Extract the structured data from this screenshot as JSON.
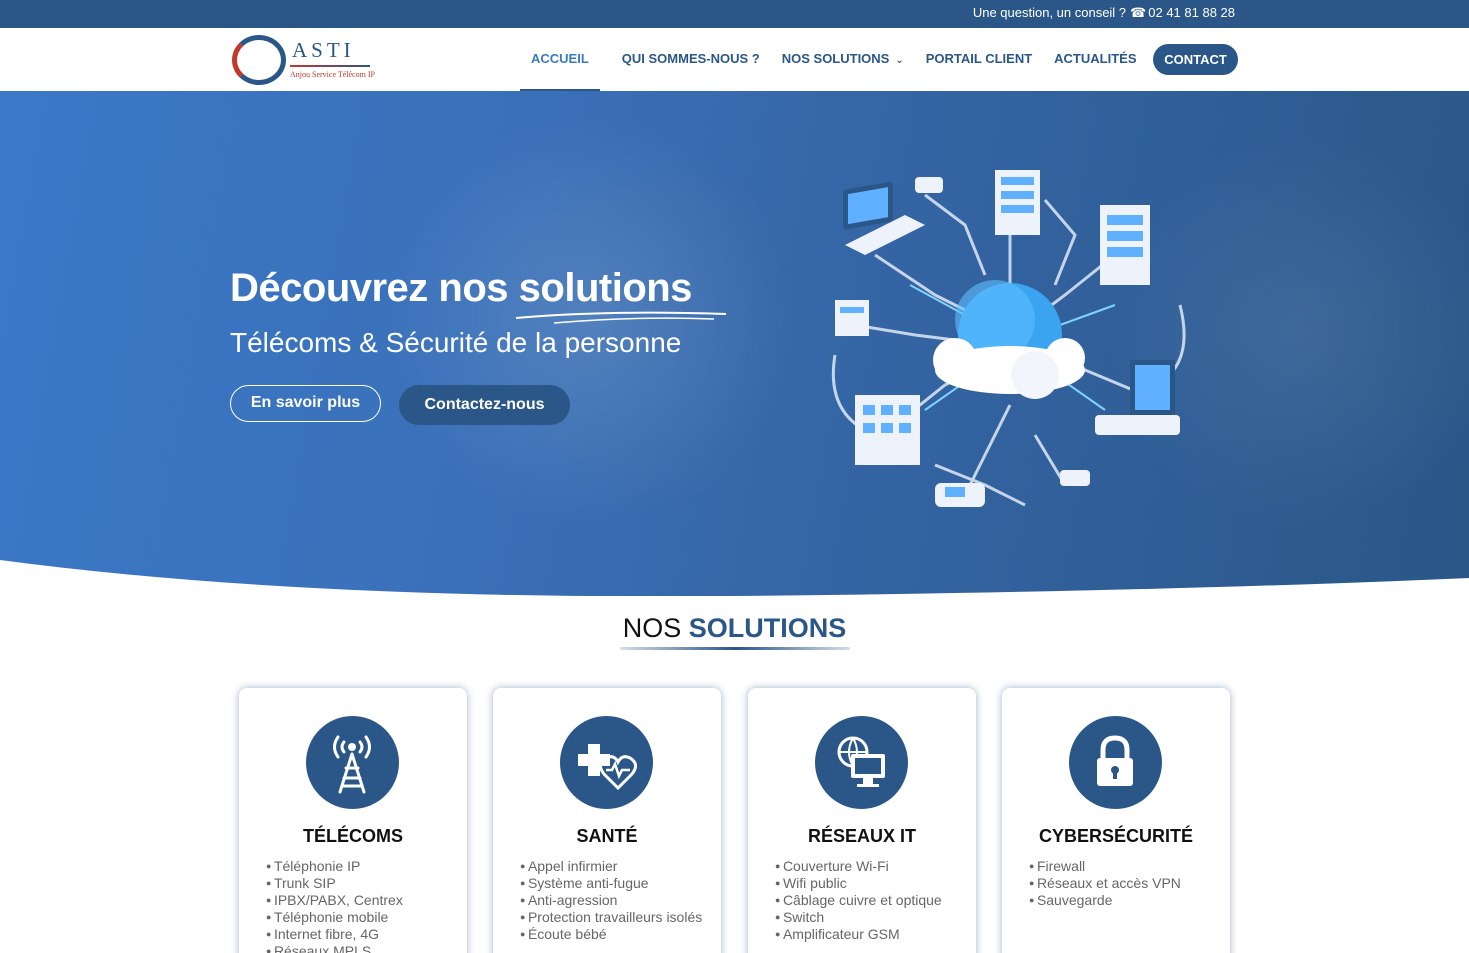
{
  "topbar": {
    "text": "Une question, un conseil ?",
    "phone_icon": "☎",
    "phone": "02 41 81 88 28"
  },
  "logo": {
    "name": "ASTI",
    "tagline": "Anjou Service Télécom IP"
  },
  "nav": {
    "items": [
      {
        "label": "ACCUEIL",
        "active": true
      },
      {
        "label": "QUI SOMMES-NOUS ?"
      },
      {
        "label": "NOS SOLUTIONS",
        "has_dropdown": true
      },
      {
        "label": "PORTAIL CLIENT"
      },
      {
        "label": "ACTUALITÉS"
      }
    ],
    "cta": "CONTACT"
  },
  "hero": {
    "title_start": "Découvrez nos ",
    "title_accent": "solutions",
    "subtitle": "Télécoms & Sécurité de la personne",
    "btn_primary": "En savoir plus",
    "btn_secondary": "Contactez-nous"
  },
  "section": {
    "title_start": "NOS ",
    "title_accent": "SOLUTIONS"
  },
  "cards": [
    {
      "icon": "antenna-tower-icon",
      "title": "TÉLÉCOMS",
      "items": [
        "Téléphonie IP",
        "Trunk SIP",
        "IPBX/PABX, Centrex",
        "Téléphonie mobile",
        "Internet fibre, 4G",
        "Réseaux MPLS"
      ]
    },
    {
      "icon": "medical-heart-icon",
      "title": "SANTÉ",
      "items": [
        "Appel infirmier",
        "Système anti-fugue",
        "Anti-agression",
        "Protection travailleurs isolés",
        "Écoute bébé"
      ]
    },
    {
      "icon": "globe-monitor-icon",
      "title": "RÉSEAUX IT",
      "items": [
        "Couverture Wi-Fi",
        "Wifi public",
        "Câblage cuivre et optique",
        "Switch",
        "Amplificateur GSM"
      ]
    },
    {
      "icon": "padlock-icon",
      "title": "CYBERSÉCURITÉ",
      "items": [
        "Firewall",
        "Réseaux et accès VPN",
        "Sauvegarde"
      ]
    }
  ],
  "colors": {
    "primary": "#2a5788",
    "accent_link": "#3a7bbf",
    "hero_light": "#3b78c8",
    "logo_red": "#c0392b"
  }
}
